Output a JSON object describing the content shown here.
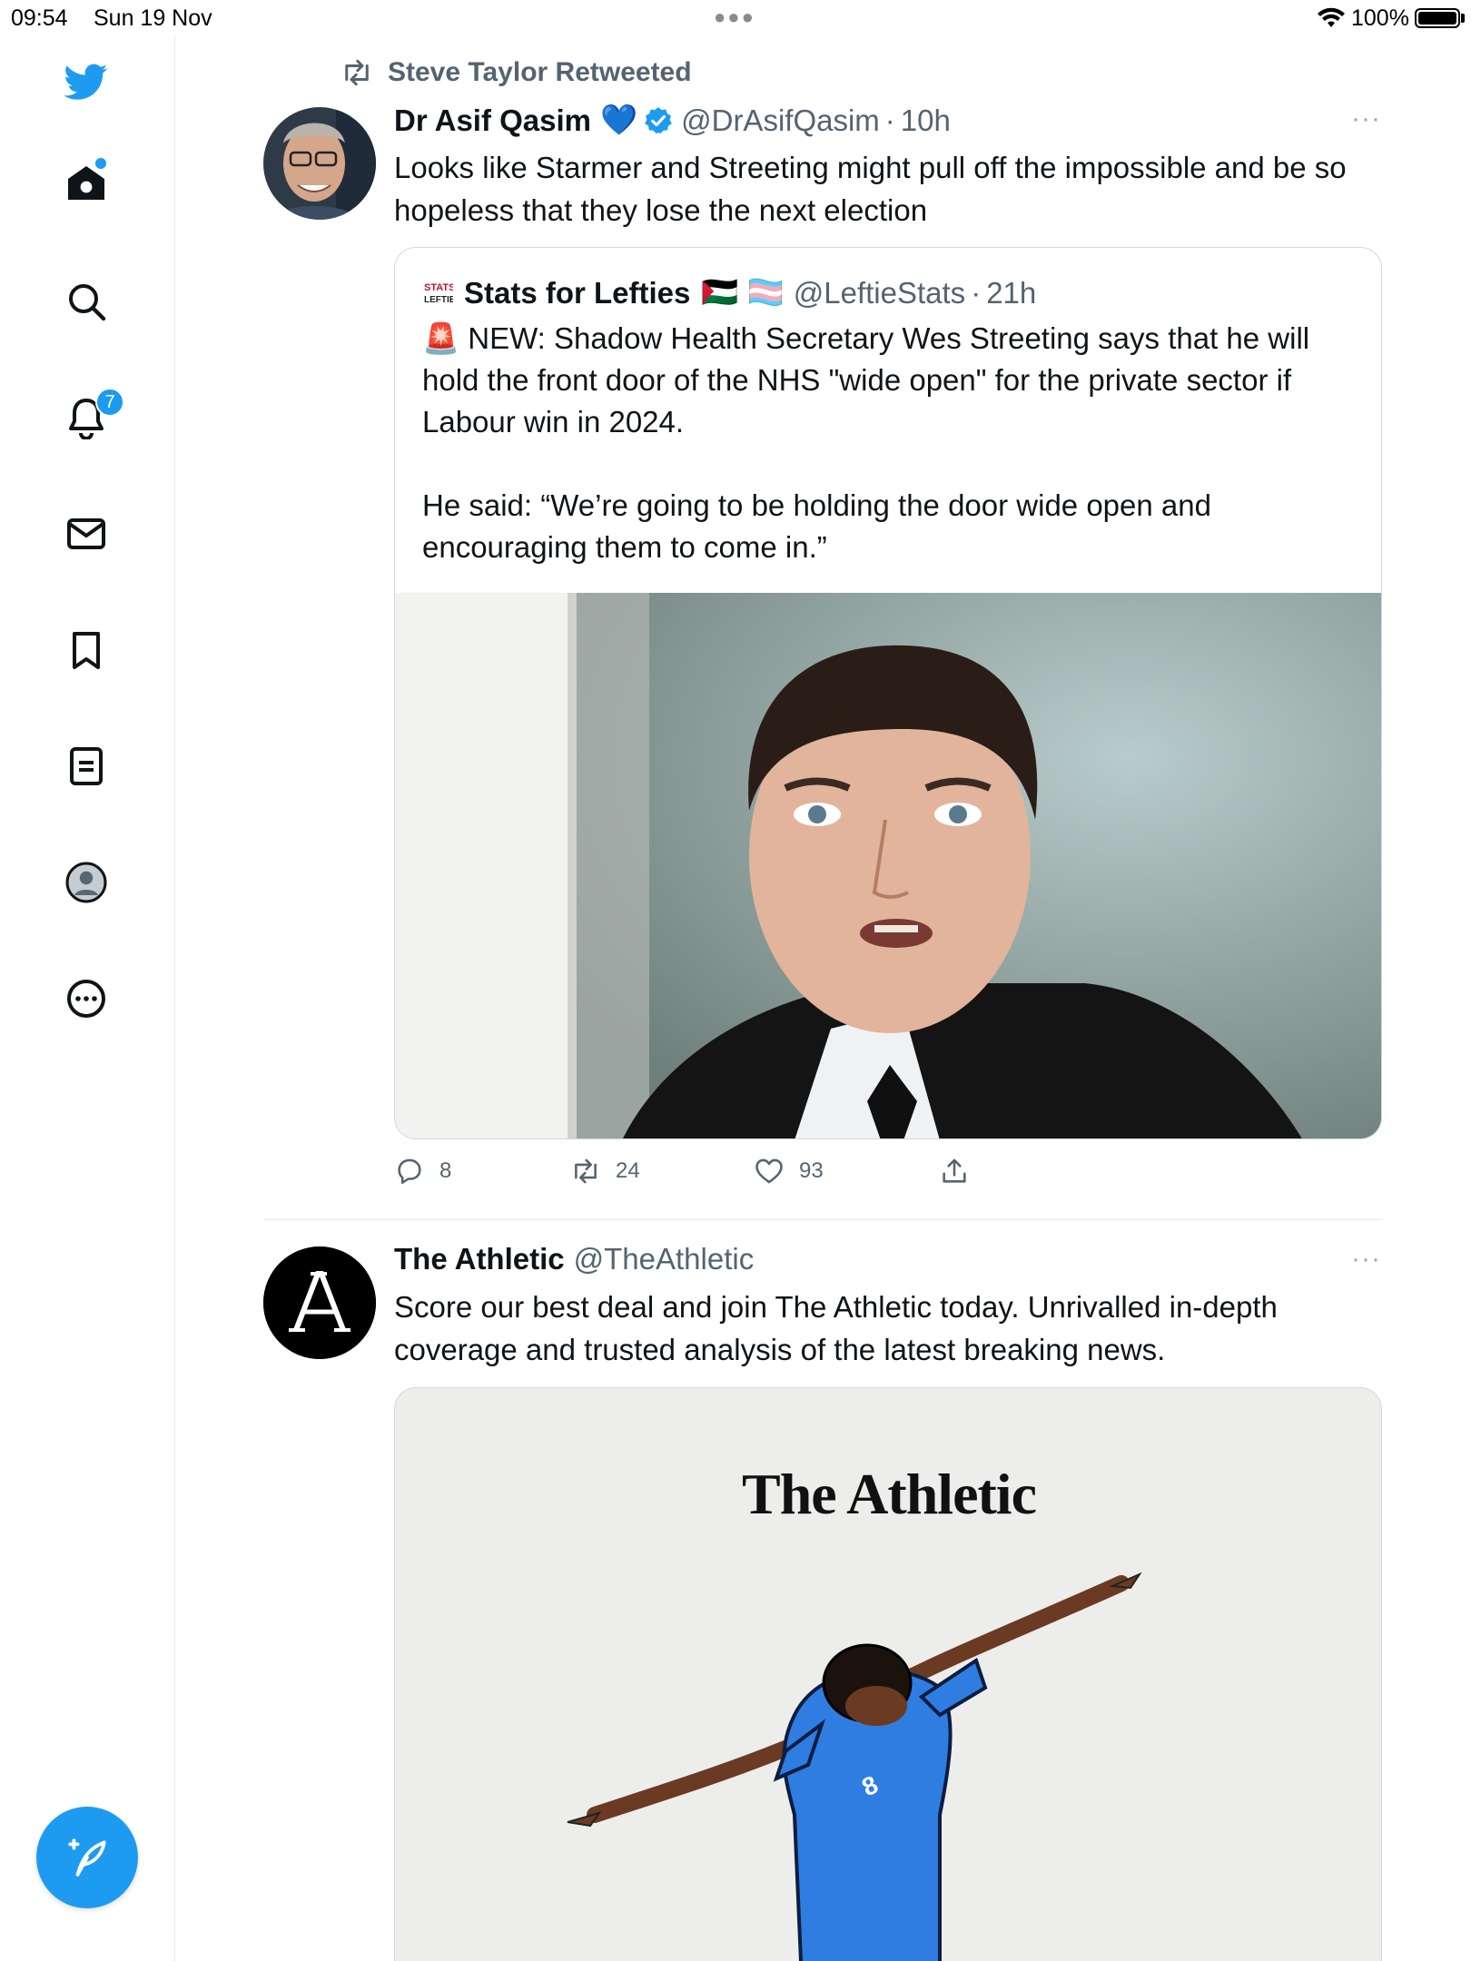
{
  "status_bar": {
    "time": "09:54",
    "date": "Sun 19 Nov",
    "battery": "100%"
  },
  "sidebar": {
    "items": [
      {
        "id": "home",
        "icon": "home-icon"
      },
      {
        "id": "explore",
        "icon": "search-icon"
      },
      {
        "id": "notifications",
        "icon": "bell-icon",
        "badge": "7"
      },
      {
        "id": "messages",
        "icon": "mail-icon"
      },
      {
        "id": "bookmarks",
        "icon": "bookmark-icon"
      },
      {
        "id": "lists",
        "icon": "list-icon"
      },
      {
        "id": "profile",
        "icon": "profile-icon"
      },
      {
        "id": "more",
        "icon": "more-circle-icon"
      }
    ],
    "compose_icon": "compose-feather-icon"
  },
  "tweet1": {
    "retweeted_by": "Steve Taylor Retweeted",
    "name": "Dr Asif Qasim",
    "name_emoji": "💙",
    "handle": "@DrAsifQasim",
    "dot": "·",
    "time": "10h",
    "more": "···",
    "text": "Looks like Starmer and Streeting might pull off the impossible and be so hopeless that they lose the next election",
    "quote": {
      "name": "Stats for Lefties",
      "flags": "🇵🇸 🏳️‍⚧️",
      "handle": "@LeftieStats",
      "dot": "·",
      "time": "21h",
      "emoji": "🚨",
      "para1": "NEW: Shadow Health Secretary Wes Streeting says that he will hold the front door of the NHS \"wide open\" for the private sector if Labour win in 2024.",
      "para2": "He said: “We’re going to be holding the door wide open and encouraging them to come in.”"
    },
    "actions": {
      "replies": "8",
      "retweets": "24",
      "likes": "93"
    }
  },
  "tweet2": {
    "name": "The Athletic",
    "handle": "@TheAthletic",
    "more": "···",
    "text": "Score our best deal and join The Athletic today. Unrivalled in-depth coverage and trusted analysis of the latest breaking news.",
    "card_title": "The Athletic",
    "jersey_number": "8"
  },
  "colors": {
    "accent": "#1d9bf0",
    "text": "#0f1419",
    "secondary": "#536471",
    "border": "#cfd9de",
    "verified": "#1d9bf0"
  }
}
